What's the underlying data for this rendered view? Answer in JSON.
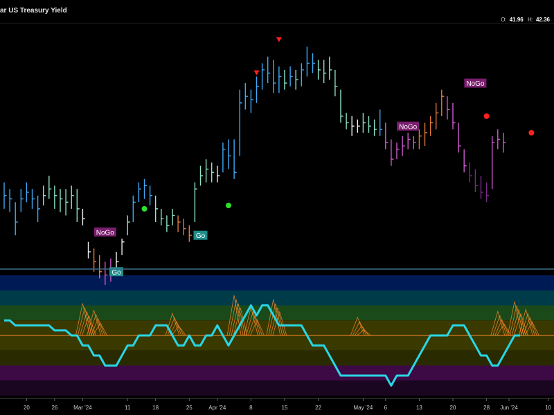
{
  "header": {
    "title": "ar US Treasury Yield",
    "ohlc": {
      "o_label": "O:",
      "o_value": "41.96",
      "h_label": "H:",
      "h_value": "42.36"
    }
  },
  "colors": {
    "background": "#000000",
    "strong_go": "#3fa9f5",
    "go": "#8fe3c8",
    "go_fading": "#f0f0f0",
    "nogo_fading": "#e07a3a",
    "nogo": "#d05ad0",
    "strong_nogo": "#7a2a8a",
    "go_dot": "#2de02d",
    "nogo_dot": "#ff2020",
    "go_label_bg": "#1e8c8c",
    "nogo_label_bg": "#7a1e6e",
    "oscillator": "#29d6e6",
    "zero_line": "#ff8a2a",
    "divider": "#3d6d8a"
  },
  "chart_data": {
    "type": "line",
    "price_panel": {
      "y_range": [
        26,
        100
      ],
      "bars": [
        {
          "h": 52,
          "l": 44,
          "c": 48,
          "col": "strong_go"
        },
        {
          "h": 50,
          "l": 43,
          "c": 47,
          "col": "strong_go"
        },
        {
          "h": 46,
          "l": 36,
          "c": 40,
          "col": "strong_go"
        },
        {
          "h": 50,
          "l": 43,
          "c": 47,
          "col": "strong_go"
        },
        {
          "h": 52,
          "l": 46,
          "c": 49,
          "col": "strong_go"
        },
        {
          "h": 50,
          "l": 44,
          "c": 47,
          "col": "strong_go"
        },
        {
          "h": 48,
          "l": 40,
          "c": 44,
          "col": "strong_go"
        },
        {
          "h": 51,
          "l": 45,
          "c": 48,
          "col": "go"
        },
        {
          "h": 54,
          "l": 47,
          "c": 50,
          "col": "go"
        },
        {
          "h": 51,
          "l": 44,
          "c": 48,
          "col": "go"
        },
        {
          "h": 50,
          "l": 43,
          "c": 47,
          "col": "go"
        },
        {
          "h": 50,
          "l": 42,
          "c": 46,
          "col": "go"
        },
        {
          "h": 51,
          "l": 44,
          "c": 48,
          "col": "go"
        },
        {
          "h": 50,
          "l": 40,
          "c": 44,
          "col": "go"
        },
        {
          "h": 44,
          "l": 39,
          "c": 41,
          "col": "go_fading"
        },
        {
          "h": 34,
          "l": 29,
          "c": 31,
          "col": "go_fading"
        },
        {
          "h": 32,
          "l": 25,
          "c": 28,
          "col": "nogo_fading"
        },
        {
          "h": 30,
          "l": 23,
          "c": 25,
          "col": "nogo_fading"
        },
        {
          "h": 28,
          "l": 21,
          "c": 24,
          "col": "nogo"
        },
        {
          "h": 29,
          "l": 22,
          "c": 25,
          "col": "nogo"
        },
        {
          "h": 31,
          "l": 25,
          "c": 28,
          "col": "go_fading"
        },
        {
          "h": 35,
          "l": 30,
          "c": 34,
          "col": "go_fading"
        },
        {
          "h": 42,
          "l": 36,
          "c": 40,
          "col": "go"
        },
        {
          "h": 48,
          "l": 40,
          "c": 46,
          "col": "strong_go"
        },
        {
          "h": 52,
          "l": 46,
          "c": 50,
          "col": "strong_go"
        },
        {
          "h": 53,
          "l": 47,
          "c": 51,
          "col": "strong_go"
        },
        {
          "h": 51,
          "l": 45,
          "c": 48,
          "col": "strong_go"
        },
        {
          "h": 48,
          "l": 40,
          "c": 44,
          "col": "go"
        },
        {
          "h": 44,
          "l": 39,
          "c": 41,
          "col": "go"
        },
        {
          "h": 42,
          "l": 37,
          "c": 39,
          "col": "go"
        },
        {
          "h": 44,
          "l": 39,
          "c": 42,
          "col": "go"
        },
        {
          "h": 42,
          "l": 37,
          "c": 40,
          "col": "nogo_fading"
        },
        {
          "h": 41,
          "l": 36,
          "c": 38,
          "col": "nogo_fading"
        },
        {
          "h": 39,
          "l": 34,
          "c": 36,
          "col": "nogo_fading"
        },
        {
          "h": 52,
          "l": 40,
          "c": 50,
          "col": "go"
        },
        {
          "h": 57,
          "l": 51,
          "c": 54,
          "col": "go"
        },
        {
          "h": 59,
          "l": 52,
          "c": 56,
          "col": "go"
        },
        {
          "h": 58,
          "l": 52,
          "c": 55,
          "col": "go"
        },
        {
          "h": 57,
          "l": 52,
          "c": 54,
          "col": "go_fading"
        },
        {
          "h": 64,
          "l": 55,
          "c": 62,
          "col": "strong_go"
        },
        {
          "h": 65,
          "l": 56,
          "c": 60,
          "col": "strong_go"
        },
        {
          "h": 65,
          "l": 53,
          "c": 55,
          "col": "strong_go"
        },
        {
          "h": 80,
          "l": 60,
          "c": 76,
          "col": "strong_go"
        },
        {
          "h": 82,
          "l": 74,
          "c": 78,
          "col": "strong_go"
        },
        {
          "h": 80,
          "l": 73,
          "c": 77,
          "col": "strong_go"
        },
        {
          "h": 84,
          "l": 76,
          "c": 81,
          "col": "strong_go"
        },
        {
          "h": 88,
          "l": 80,
          "c": 86,
          "col": "strong_go"
        },
        {
          "h": 90,
          "l": 82,
          "c": 85,
          "col": "strong_go"
        },
        {
          "h": 89,
          "l": 79,
          "c": 82,
          "col": "strong_go"
        },
        {
          "h": 87,
          "l": 79,
          "c": 84,
          "col": "strong_go"
        },
        {
          "h": 86,
          "l": 80,
          "c": 82,
          "col": "go"
        },
        {
          "h": 87,
          "l": 81,
          "c": 84,
          "col": "strong_go"
        },
        {
          "h": 86,
          "l": 80,
          "c": 83,
          "col": "go"
        },
        {
          "h": 88,
          "l": 81,
          "c": 86,
          "col": "strong_go"
        },
        {
          "h": 93,
          "l": 84,
          "c": 88,
          "col": "strong_go"
        },
        {
          "h": 91,
          "l": 85,
          "c": 88,
          "col": "strong_go"
        },
        {
          "h": 89,
          "l": 83,
          "c": 86,
          "col": "go"
        },
        {
          "h": 89,
          "l": 82,
          "c": 85,
          "col": "go"
        },
        {
          "h": 90,
          "l": 83,
          "c": 86,
          "col": "go"
        },
        {
          "h": 86,
          "l": 78,
          "c": 81,
          "col": "go"
        },
        {
          "h": 80,
          "l": 70,
          "c": 72,
          "col": "go"
        },
        {
          "h": 73,
          "l": 68,
          "c": 70,
          "col": "go"
        },
        {
          "h": 72,
          "l": 66,
          "c": 69,
          "col": "go_fading"
        },
        {
          "h": 71,
          "l": 67,
          "c": 69,
          "col": "go_fading"
        },
        {
          "h": 73,
          "l": 67,
          "c": 70,
          "col": "go"
        },
        {
          "h": 72,
          "l": 67,
          "c": 69,
          "col": "go"
        },
        {
          "h": 71,
          "l": 66,
          "c": 68,
          "col": "go"
        },
        {
          "h": 74,
          "l": 66,
          "c": 68,
          "col": "strong_go"
        },
        {
          "h": 70,
          "l": 62,
          "c": 64,
          "col": "nogo"
        },
        {
          "h": 65,
          "l": 57,
          "c": 59,
          "col": "nogo"
        },
        {
          "h": 64,
          "l": 59,
          "c": 62,
          "col": "nogo"
        },
        {
          "h": 66,
          "l": 60,
          "c": 63,
          "col": "nogo"
        },
        {
          "h": 67,
          "l": 62,
          "c": 65,
          "col": "nogo"
        },
        {
          "h": 66,
          "l": 62,
          "c": 64,
          "col": "nogo"
        },
        {
          "h": 68,
          "l": 62,
          "c": 66,
          "col": "nogo_fading"
        },
        {
          "h": 70,
          "l": 63,
          "c": 67,
          "col": "nogo_fading"
        },
        {
          "h": 72,
          "l": 66,
          "c": 70,
          "col": "nogo_fading"
        },
        {
          "h": 76,
          "l": 68,
          "c": 73,
          "col": "nogo_fading"
        },
        {
          "h": 80,
          "l": 72,
          "c": 78,
          "col": "nogo_fading"
        },
        {
          "h": 78,
          "l": 71,
          "c": 74,
          "col": "nogo"
        },
        {
          "h": 76,
          "l": 68,
          "c": 70,
          "col": "nogo"
        },
        {
          "h": 70,
          "l": 61,
          "c": 63,
          "col": "nogo"
        },
        {
          "h": 62,
          "l": 55,
          "c": 57,
          "col": "nogo"
        },
        {
          "h": 58,
          "l": 52,
          "c": 54,
          "col": "strong_nogo"
        },
        {
          "h": 56,
          "l": 49,
          "c": 51,
          "col": "strong_nogo"
        },
        {
          "h": 54,
          "l": 47,
          "c": 49,
          "col": "strong_nogo"
        },
        {
          "h": 52,
          "l": 46,
          "c": 48,
          "col": "strong_nogo"
        },
        {
          "h": 66,
          "l": 50,
          "c": 64,
          "col": "nogo"
        },
        {
          "h": 68,
          "l": 62,
          "c": 65,
          "col": "nogo"
        },
        {
          "h": 67,
          "l": 61,
          "c": 64,
          "col": "nogo"
        }
      ],
      "signals": [
        {
          "bar": 20,
          "price": 25,
          "type": "go_label",
          "text": "Go"
        },
        {
          "bar": 18,
          "price": 37,
          "type": "nogo_label",
          "text": "NoGo"
        },
        {
          "bar": 25,
          "price": 44,
          "type": "go_dot"
        },
        {
          "bar": 35,
          "price": 36,
          "type": "go_label",
          "text": "Go"
        },
        {
          "bar": 40,
          "price": 45,
          "type": "go_dot"
        },
        {
          "bar": 45,
          "price": 85,
          "type": "nogo_triangle"
        },
        {
          "bar": 49,
          "price": 95,
          "type": "nogo_triangle"
        },
        {
          "bar": 72,
          "price": 69,
          "type": "nogo_label",
          "text": "NoGo"
        },
        {
          "bar": 84,
          "price": 82,
          "type": "nogo_label",
          "text": "NoGo"
        },
        {
          "bar": 86,
          "price": 72,
          "type": "nogo_dot"
        },
        {
          "bar": 94,
          "price": 67,
          "type": "nogo_dot"
        }
      ]
    },
    "oscillator_panel": {
      "y_range": [
        -6,
        6
      ],
      "values": [
        1.5,
        1.5,
        1.0,
        1.0,
        1.0,
        1.0,
        1.0,
        1.0,
        1.0,
        0.5,
        0.5,
        0.5,
        0.0,
        0.0,
        -1.0,
        -1.0,
        -2.0,
        -2.0,
        -3.0,
        -3.0,
        -3.0,
        -2.0,
        -1.0,
        -1.0,
        0.0,
        0.0,
        0.0,
        1.0,
        1.0,
        1.0,
        0.0,
        -1.0,
        -1.0,
        0.0,
        -1.0,
        -1.0,
        0.0,
        0.0,
        1.0,
        0.0,
        -1.0,
        0.0,
        1.0,
        2.0,
        3.0,
        2.0,
        3.0,
        3.0,
        2.0,
        1.0,
        1.0,
        1.0,
        1.0,
        1.0,
        0.0,
        -1.0,
        -1.0,
        -1.0,
        -2.0,
        -3.0,
        -4.0,
        -4.0,
        -4.0,
        -4.0,
        -4.0,
        -4.0,
        -4.0,
        -4.0,
        -4.0,
        -5.0,
        -4.0,
        -4.0,
        -4.0,
        -3.0,
        -2.0,
        -1.0,
        0.0,
        0.0,
        0.0,
        0.0,
        1.0,
        1.0,
        1.0,
        0.0,
        -1.0,
        -2.0,
        -2.0,
        -3.0,
        -3.0,
        -2.0,
        -1.0,
        0.0,
        0.0
      ],
      "bands": [
        {
          "from": 4.5,
          "to": 6,
          "color": "#001a55"
        },
        {
          "from": 3,
          "to": 4.5,
          "color": "#003b4a"
        },
        {
          "from": 1.5,
          "to": 3,
          "color": "#1a4a1a"
        },
        {
          "from": 0,
          "to": 1.5,
          "color": "#3a3a00"
        },
        {
          "from": -1.5,
          "to": 0,
          "color": "#3a3a00"
        },
        {
          "from": -3,
          "to": -1.5,
          "color": "#2a2a00"
        },
        {
          "from": -4.5,
          "to": -3,
          "color": "#3d0a45"
        },
        {
          "from": -6,
          "to": -4.5,
          "color": "#1a0620"
        }
      ],
      "volume_spikes": [
        {
          "bar": 14,
          "height": 3.2
        },
        {
          "bar": 16,
          "height": 2.5
        },
        {
          "bar": 30,
          "height": 2.2
        },
        {
          "bar": 41,
          "height": 4.0
        },
        {
          "bar": 44,
          "height": 2.8
        },
        {
          "bar": 48,
          "height": 3.6
        },
        {
          "bar": 63,
          "height": 1.8
        },
        {
          "bar": 88,
          "height": 2.4
        },
        {
          "bar": 91,
          "height": 3.4
        },
        {
          "bar": 93,
          "height": 2.6
        }
      ]
    },
    "x_ticks": [
      {
        "bar": 4,
        "label": "20"
      },
      {
        "bar": 9,
        "label": "26"
      },
      {
        "bar": 14,
        "label": "Mar '24"
      },
      {
        "bar": 22,
        "label": "11"
      },
      {
        "bar": 27,
        "label": "18"
      },
      {
        "bar": 33,
        "label": "25"
      },
      {
        "bar": 38,
        "label": "Apr '24"
      },
      {
        "bar": 44,
        "label": "8"
      },
      {
        "bar": 50,
        "label": "15"
      },
      {
        "bar": 56,
        "label": "22"
      },
      {
        "bar": 64,
        "label": "May '24"
      },
      {
        "bar": 68,
        "label": "6"
      },
      {
        "bar": 74,
        "label": "13"
      },
      {
        "bar": 80,
        "label": "20"
      },
      {
        "bar": 86,
        "label": "28"
      },
      {
        "bar": 90,
        "label": "Jun '24"
      },
      {
        "bar": 97,
        "label": "10"
      }
    ]
  }
}
